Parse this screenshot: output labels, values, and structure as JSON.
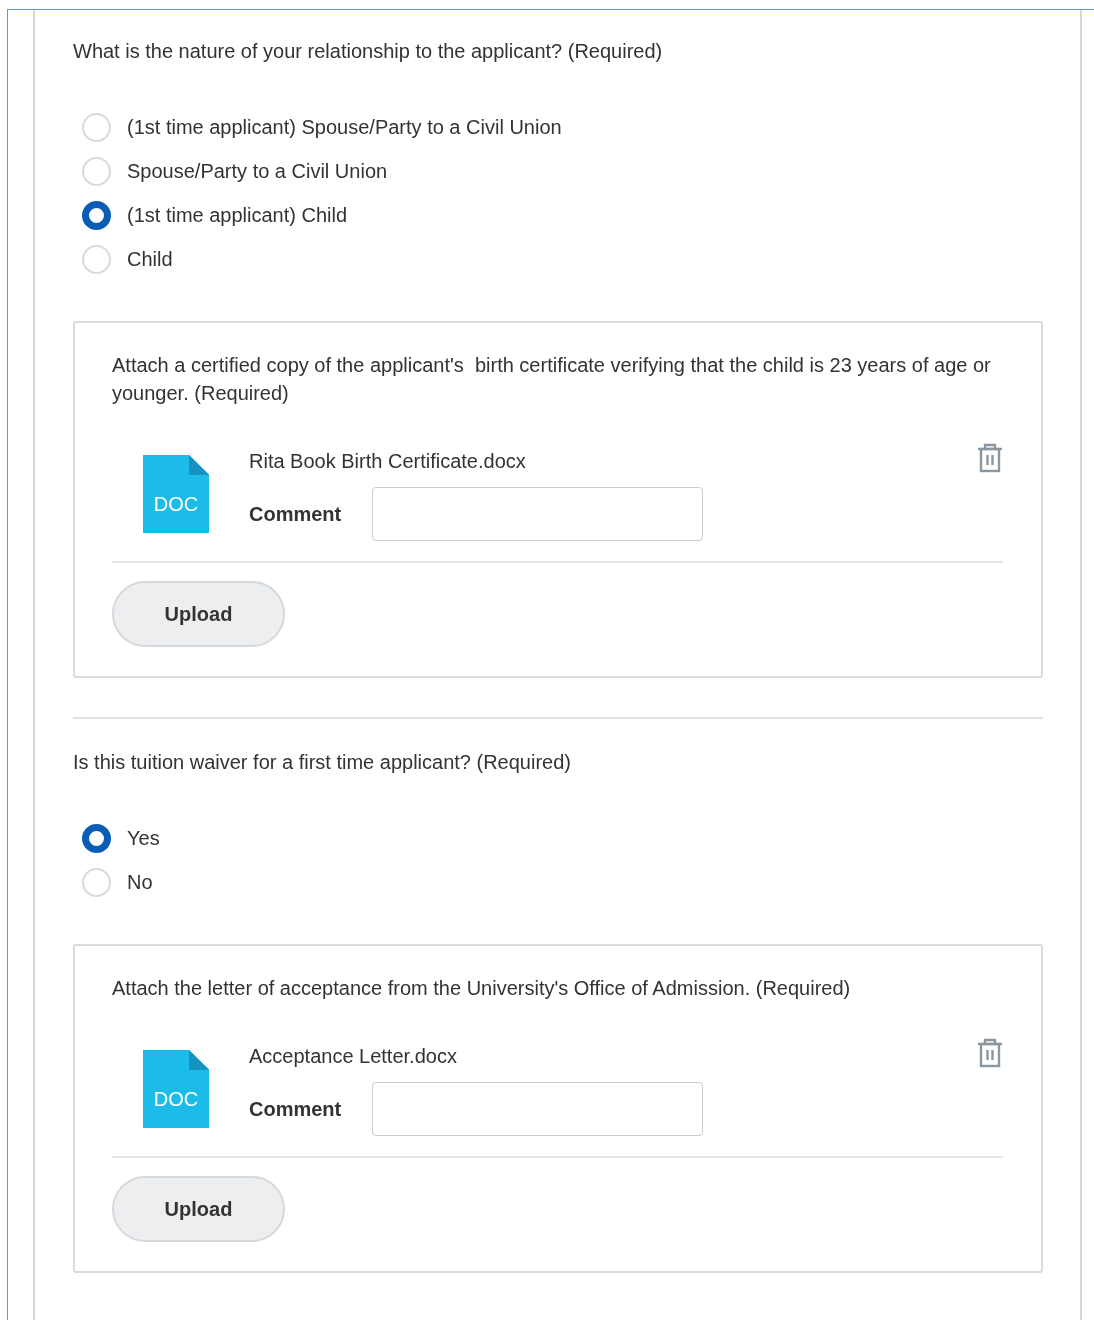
{
  "questions": [
    {
      "prompt": "What is the nature of your relationship to the applicant? (Required)",
      "options": [
        {
          "label": "(1st time applicant) Spouse/Party to a Civil Union",
          "selected": false
        },
        {
          "label": "Spouse/Party to a Civil Union",
          "selected": false
        },
        {
          "label": "(1st time applicant) Child",
          "selected": true
        },
        {
          "label": "Child",
          "selected": false
        }
      ],
      "attachment": {
        "instruction": "Attach a certified copy of the applicant's  birth certificate verifying that the child is 23 years of age or younger. (Required)",
        "file": {
          "type_label": "DOC",
          "name": "Rita Book Birth Certificate.docx",
          "comment_label": "Comment"
        },
        "button": "Upload"
      }
    },
    {
      "prompt": "Is this tuition waiver for a first time applicant? (Required)",
      "options": [
        {
          "label": "Yes",
          "selected": true
        },
        {
          "label": "No",
          "selected": false
        }
      ],
      "attachment": {
        "instruction": "Attach the letter of acceptance from the University's Office of Admission. (Required)",
        "file": {
          "type_label": "DOC",
          "name": "Acceptance Letter.docx",
          "comment_label": "Comment"
        },
        "button": "Upload"
      }
    }
  ]
}
